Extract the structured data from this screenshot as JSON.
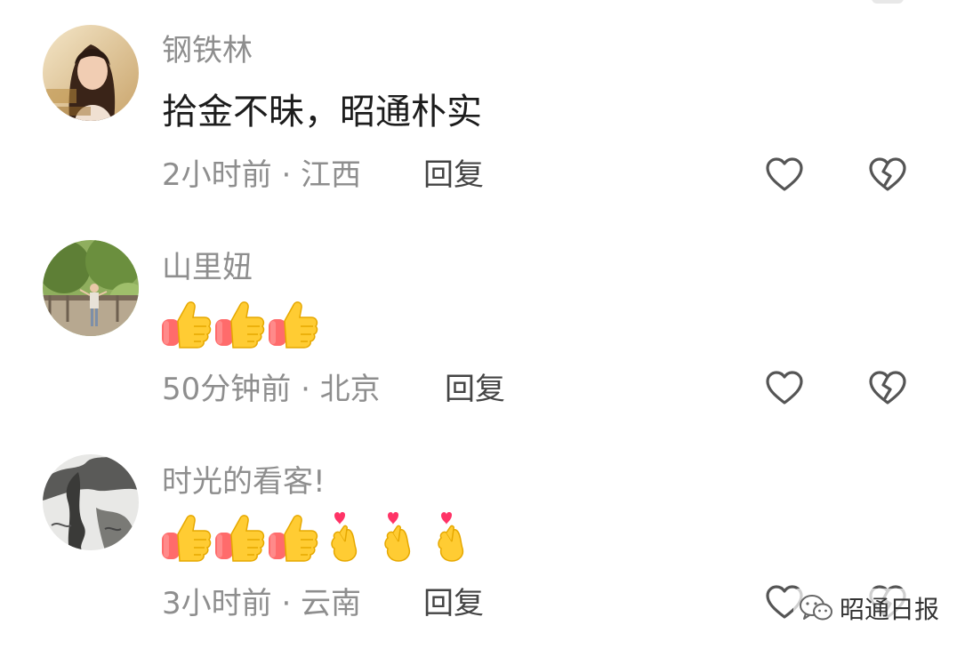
{
  "comments": [
    {
      "username": "钢铁林",
      "text": "拾金不昧，昭通朴实",
      "meta": "2小时前 · 江西",
      "reply_label": "回复",
      "like_icon": "heart-outline-icon",
      "dislike_icon": "broken-heart-icon"
    },
    {
      "username": "山里妞",
      "emojis": [
        "thumbs-up",
        "thumbs-up",
        "thumbs-up"
      ],
      "meta": "50分钟前 · 北京",
      "reply_label": "回复",
      "like_icon": "heart-outline-icon",
      "dislike_icon": "broken-heart-icon"
    },
    {
      "username": "时光的看客!",
      "emojis": [
        "thumbs-up",
        "thumbs-up",
        "thumbs-up",
        "finger-heart",
        "finger-heart",
        "finger-heart"
      ],
      "meta": "3小时前 · 云南",
      "reply_label": "回复",
      "like_icon": "heart-outline-icon",
      "dislike_icon": "broken-heart-icon"
    }
  ],
  "watermark": {
    "text": "昭通日报",
    "icon": "wechat-icon"
  },
  "colors": {
    "username": "#8e8e8e",
    "text": "#1c1c1c",
    "meta": "#8e8e8e",
    "reply": "#444444",
    "icon": "#555555",
    "emoji_yellow": "#ffcc33",
    "emoji_sleeve": "#ff6b6b",
    "heart_red": "#ff3366"
  }
}
